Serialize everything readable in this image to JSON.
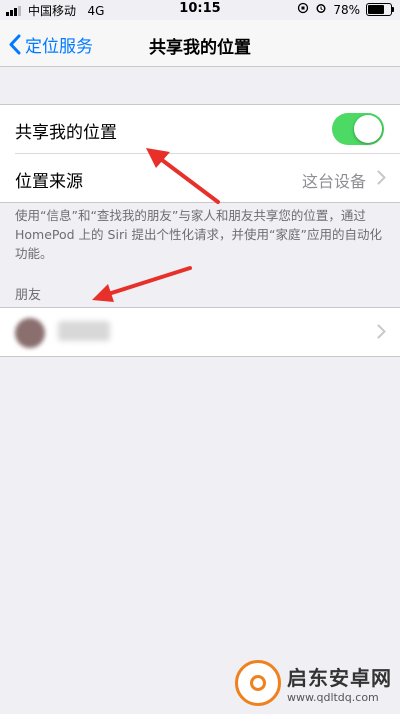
{
  "status_bar": {
    "carrier": "中国移动",
    "network": "4G",
    "time": "10:15",
    "battery": "78%",
    "battery_level": 0.78
  },
  "nav": {
    "back_label": "定位服务",
    "title": "共享我的位置"
  },
  "settings": {
    "share_location_label": "共享我的位置",
    "share_location_on": true,
    "location_source_label": "位置来源",
    "location_source_value": "这台设备",
    "footer_text": "使用“信息”和“查找我的朋友”与家人和朋友共享您的位置，通过 HomePod 上的 Siri 提出个性化请求，并使用“家庭”应用的自动化功能。"
  },
  "friends": {
    "header": "朋友",
    "items": [
      {
        "name": "████"
      }
    ]
  },
  "watermark": {
    "name": "启东安卓网",
    "url": "www.qdltdq.com"
  },
  "colors": {
    "accent": "#007aff",
    "toggle_on": "#4cd964",
    "annotation_arrow": "#e8302a"
  }
}
